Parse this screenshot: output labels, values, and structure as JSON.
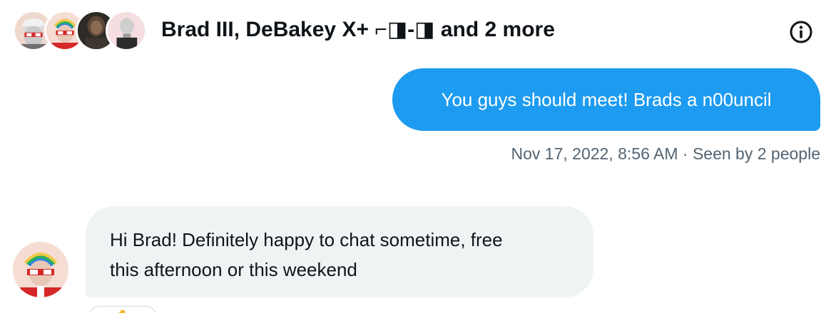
{
  "conversation": {
    "title": "Brad III, DeBakey X+ ⌐◨-◨ and 2 more",
    "participants_avatars": [
      "avatar-white-hat",
      "avatar-rainbow-hair",
      "avatar-dark-figure",
      "avatar-bald-figure"
    ],
    "info_icon": "info-icon"
  },
  "messages": [
    {
      "direction": "outgoing",
      "text": "You guys should meet! Brads a n00uncil",
      "timestamp": "Nov 17, 2022, 8:56 AM",
      "separator": "·",
      "seen": "Seen by 2 people"
    },
    {
      "direction": "incoming",
      "text_line1": "Hi Brad! Definitely happy to chat sometime, free",
      "text_line2": "this afternoon or this weekend",
      "avatar": "avatar-rainbow-hair"
    }
  ],
  "colors": {
    "accent": "#1d9bf0",
    "incoming_bubble": "#eff3f4",
    "meta_text": "#536471",
    "text": "#0f1419"
  }
}
